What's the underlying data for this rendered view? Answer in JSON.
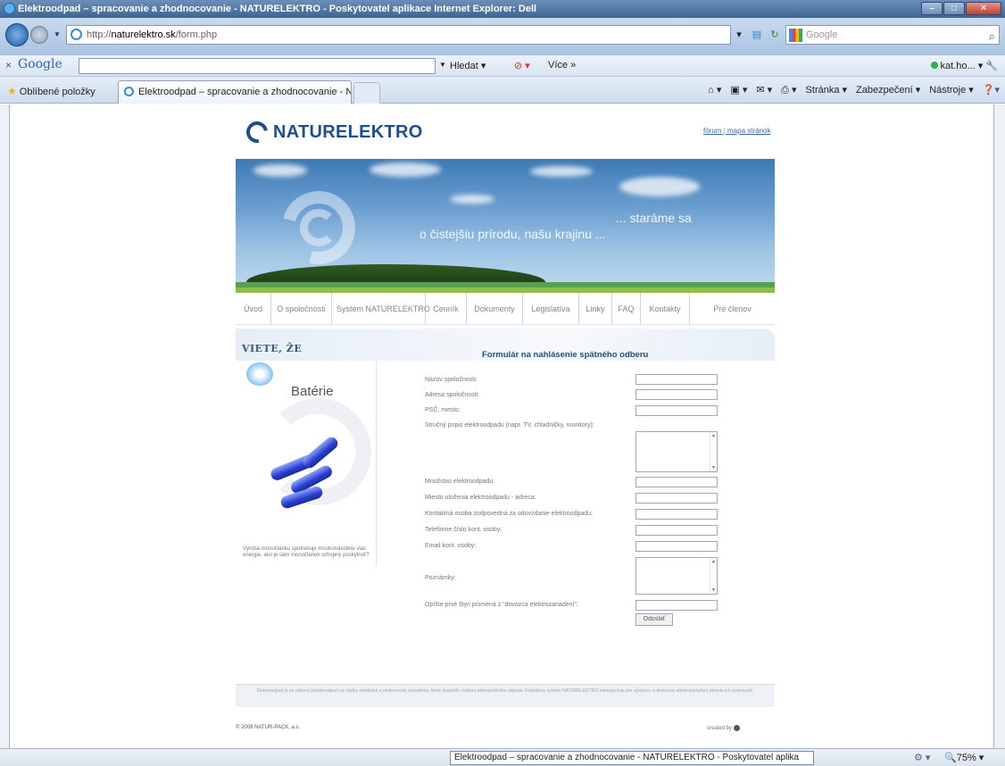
{
  "window": {
    "title": "Elektroodpad – spracovanie a zhodnocovanie - NATURELEKTRO - Poskytovatel aplikace Internet Explorer: Dell"
  },
  "address_bar": {
    "url_prefix": "http://",
    "url_host": "naturelektro.sk",
    "url_path": "/form.php",
    "search_placeholder": "Google"
  },
  "google_toolbar": {
    "logo": "Google",
    "search_label": "Hledat",
    "more_label": "Více »",
    "account": "kat.ho..."
  },
  "tab_bar": {
    "favorites_label": "Oblíbené položky",
    "tab_title": "Elektroodpad – spracovanie a zhodnocovanie - N...",
    "commands": [
      "Stránka ▾",
      "Zabezpečení ▾",
      "Nástroje ▾"
    ]
  },
  "site": {
    "logo_text": "NATURELEKTRO",
    "top_links": {
      "forum": "fórum",
      "sitemap": "mapa stránok"
    },
    "banner": {
      "slogan_left": "o čistejšiu prírodu, našu krajinu ...",
      "slogan_right": "... staráme sa"
    },
    "menu": [
      "Úvod",
      "O spoločnosti",
      "Systém NATURELEKTRO",
      "Cenník",
      "Dokumenty",
      "Legislatíva",
      "Linky",
      "FAQ",
      "Kontakty",
      "Pre členov"
    ],
    "sidebar": {
      "heading": "VIETE, ŽE",
      "topic": "Batérie",
      "text": "Výroba monočlánku spotrebuje mnohonásobne viac energie, ako je sám monočlánok schopný poskytnúť?"
    },
    "form": {
      "title": "Formulár na nahlásenie spätného odberu",
      "fields": [
        {
          "label": "Názov spoločnosti:",
          "type": "input",
          "value": ""
        },
        {
          "label": "Adresa spoločnosti:",
          "type": "input",
          "value": ""
        },
        {
          "label": "PSČ, mesto:",
          "type": "input",
          "value": ""
        },
        {
          "label": "Stručný popis elektroodpadu (napr. TV, chladničky, monitory):",
          "type": "textarea",
          "value": ""
        },
        {
          "label": "Množstvo elektroodpadu:",
          "type": "input",
          "value": ""
        },
        {
          "label": "Miesto uloženia elektroodpadu - adresa:",
          "type": "input",
          "value": ""
        },
        {
          "label": "Kontaktná osoba zodpovedná za odovzdanie elektroodpadu:",
          "type": "input",
          "value": ""
        },
        {
          "label": "Telefónne číslo kont. osoby:",
          "type": "input",
          "value": ""
        },
        {
          "label": "Email kont. osoby:",
          "type": "input",
          "value": ""
        },
        {
          "label": "Poznámky:",
          "type": "textarea",
          "value": ""
        },
        {
          "label": "Opíšte prvé štyri písmená z \"dovozca elektrozariadení\":",
          "type": "input",
          "value": ""
        }
      ],
      "submit_label": "Odoslať"
    },
    "footer_text": "Elektroodpad je zo zákona (elektroodpad sú všetky elektrické a elektronické zariadenia, ktoré doslúžili) zložkou nebezpečného odpadu. Kolektívny systém NATURELEKTRO zabezpečuje pre výrobcov a dovozcov elektrozariadení plnenie ich povinností.",
    "copyright": "© 2008 NATUR-PACK, a.s.",
    "created_by": "created by"
  },
  "status_bar": {
    "text": "Elektroodpad – spracovanie a zhodnocovanie - NATURELEKTRO - Poskytovatel aplika",
    "zoom": "75%"
  }
}
